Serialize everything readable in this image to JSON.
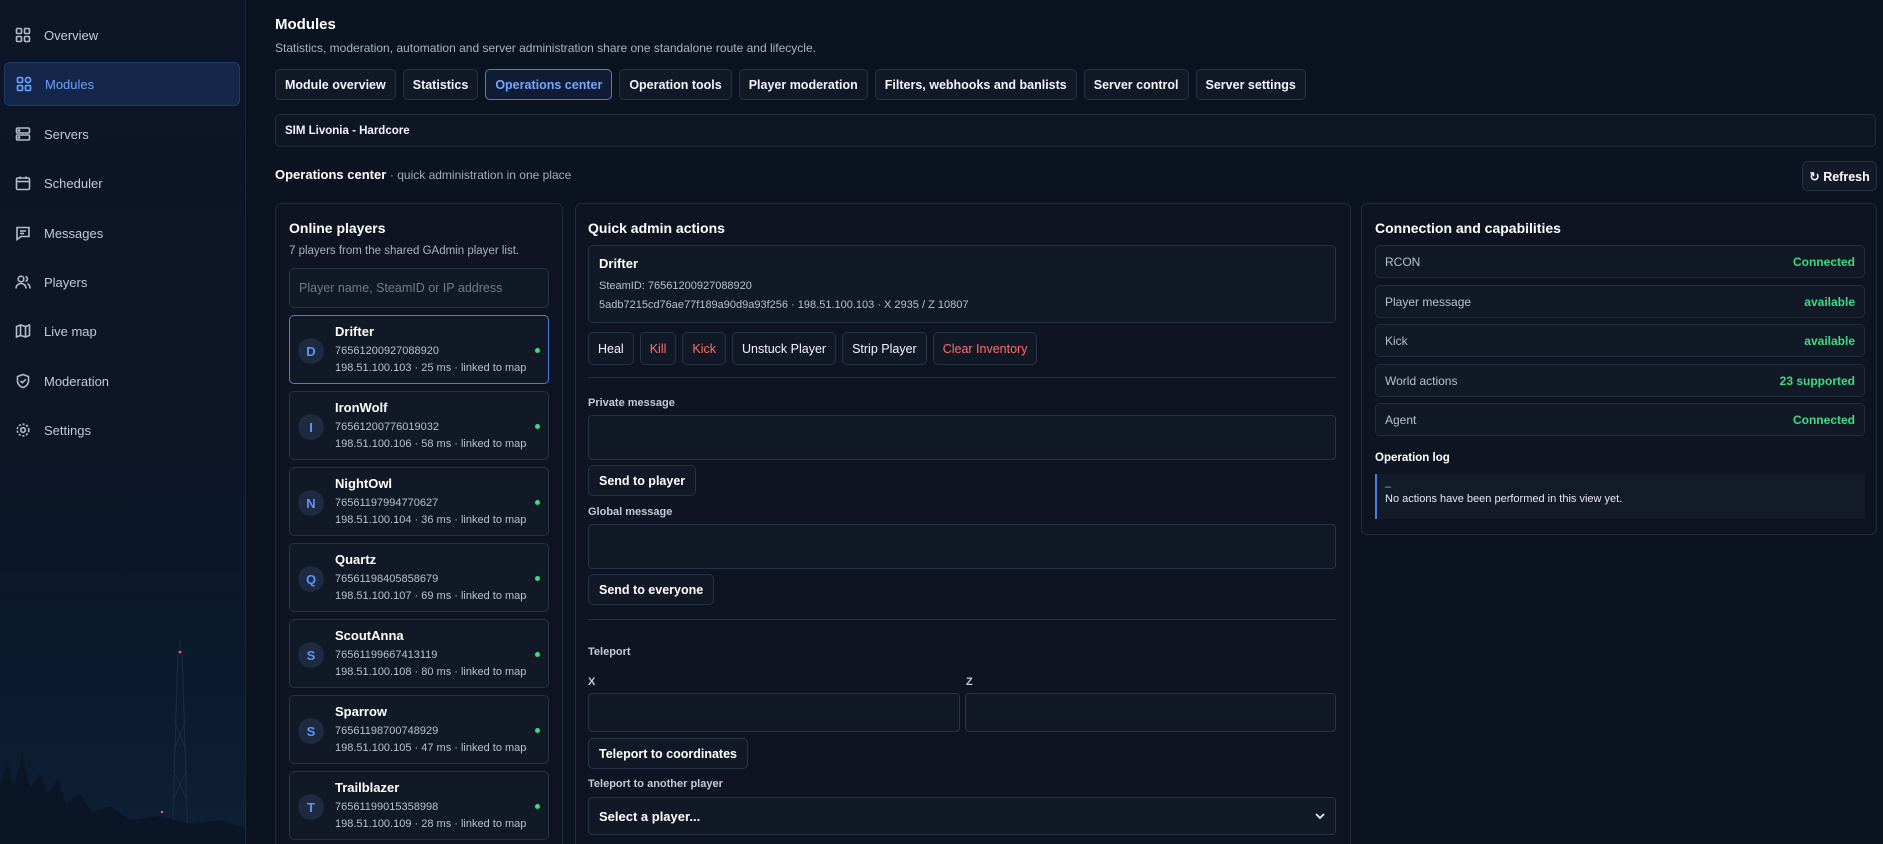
{
  "sidebar": {
    "items": [
      {
        "label": "Overview",
        "icon": "grid-icon"
      },
      {
        "label": "Modules",
        "icon": "modules-icon",
        "active": true
      },
      {
        "label": "Servers",
        "icon": "server-icon"
      },
      {
        "label": "Scheduler",
        "icon": "calendar-icon"
      },
      {
        "label": "Messages",
        "icon": "message-icon"
      },
      {
        "label": "Players",
        "icon": "users-icon"
      },
      {
        "label": "Live map",
        "icon": "map-icon"
      },
      {
        "label": "Moderation",
        "icon": "shield-icon"
      },
      {
        "label": "Settings",
        "icon": "gear-icon"
      }
    ]
  },
  "header": {
    "title": "Modules",
    "subtitle": "Statistics, moderation, automation and server administration share one standalone route and lifecycle."
  },
  "tabs": [
    {
      "label": "Module overview"
    },
    {
      "label": "Statistics"
    },
    {
      "label": "Operations center",
      "active": true
    },
    {
      "label": "Operation tools"
    },
    {
      "label": "Player moderation"
    },
    {
      "label": "Filters, webhooks and banlists"
    },
    {
      "label": "Server control"
    },
    {
      "label": "Server settings"
    }
  ],
  "server": {
    "name": "SIM Livonia - Hardcore"
  },
  "section": {
    "title": "Operations center",
    "subtitle": "· quick administration in one place",
    "refresh_label": "↻ Refresh"
  },
  "players_panel": {
    "title": "Online players",
    "description": "7 players from the shared GAdmin player list.",
    "search_placeholder": "Player name, SteamID or IP address",
    "players": [
      {
        "initial": "D",
        "name": "Drifter",
        "steamid": "76561200927088920",
        "info": "198.51.100.103 · 25 ms · linked to map",
        "selected": true
      },
      {
        "initial": "I",
        "name": "IronWolf",
        "steamid": "76561200776019032",
        "info": "198.51.100.106 · 58 ms · linked to map"
      },
      {
        "initial": "N",
        "name": "NightOwl",
        "steamid": "76561197994770627",
        "info": "198.51.100.104 · 36 ms · linked to map"
      },
      {
        "initial": "Q",
        "name": "Quartz",
        "steamid": "76561198405858679",
        "info": "198.51.100.107 · 69 ms · linked to map"
      },
      {
        "initial": "S",
        "name": "ScoutAnna",
        "steamid": "76561199667413119",
        "info": "198.51.100.108 · 80 ms · linked to map"
      },
      {
        "initial": "S",
        "name": "Sparrow",
        "steamid": "76561198700748929",
        "info": "198.51.100.105 · 47 ms · linked to map"
      },
      {
        "initial": "T",
        "name": "Trailblazer",
        "steamid": "76561199015358998",
        "info": "198.51.100.109 · 28 ms · linked to map"
      }
    ]
  },
  "quick_panel": {
    "title": "Quick admin actions",
    "target": {
      "name": "Drifter",
      "steamid_line": "SteamID: 76561200927088920",
      "guid_line": "5adb7215cd76ae77f189a90d9a93f256 · 198.51.100.103 · X 2935 / Z 10807"
    },
    "actions": [
      {
        "label": "Heal",
        "danger": false
      },
      {
        "label": "Kill",
        "danger": true
      },
      {
        "label": "Kick",
        "danger": true
      },
      {
        "label": "Unstuck Player",
        "danger": false
      },
      {
        "label": "Strip Player",
        "danger": false
      },
      {
        "label": "Clear Inventory",
        "danger": true
      }
    ],
    "private_label": "Private message",
    "send_player_label": "Send to player",
    "global_label": "Global message",
    "send_everyone_label": "Send to everyone",
    "teleport_label": "Teleport",
    "x_label": "X",
    "z_label": "Z",
    "teleport_coords_label": "Teleport to coordinates",
    "teleport_player_label": "Teleport to another player",
    "select_player_value": "Select a player..."
  },
  "caps_panel": {
    "title": "Connection and capabilities",
    "rows": [
      {
        "key": "RCON",
        "value": "Connected"
      },
      {
        "key": "Player message",
        "value": "available"
      },
      {
        "key": "Kick",
        "value": "available"
      },
      {
        "key": "World actions",
        "value": "23 supported"
      },
      {
        "key": "Agent",
        "value": "Connected"
      }
    ],
    "log_title": "Operation log",
    "log_dash": "–",
    "log_text": "No actions have been performed in this view yet."
  },
  "colors": {
    "accent": "#4a7de0",
    "success": "#3ddc84",
    "danger": "#ff6b6b",
    "background": "#0b1220"
  }
}
